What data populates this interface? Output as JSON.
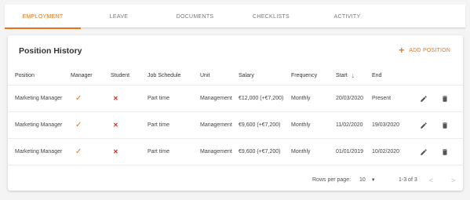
{
  "tabs": [
    {
      "label": "EMPLOYMENT",
      "active": true
    },
    {
      "label": "LEAVE",
      "active": false
    },
    {
      "label": "DOCUMENTS",
      "active": false
    },
    {
      "label": "CHECKLISTS",
      "active": false
    },
    {
      "label": "ACTIVITY",
      "active": false
    }
  ],
  "card": {
    "title": "Position History",
    "add_label": "ADD POSITION",
    "add_icon": "+"
  },
  "columns": {
    "position": "Position",
    "manager": "Manager",
    "student": "Student",
    "job_schedule": "Job Schedule",
    "unit": "Unit",
    "salary": "Salary",
    "frequency": "Frequency",
    "start": "Start",
    "end": "End"
  },
  "rows": [
    {
      "position": "Marketing Manager",
      "manager": "✓",
      "student": "✕",
      "job_schedule": "Part time",
      "unit": "Management",
      "salary": "€12,000 (+€7,200)",
      "frequency": "Monthly",
      "start": "20/03/2020",
      "end": "Present"
    },
    {
      "position": "Marketing Manager",
      "manager": "✓",
      "student": "✕",
      "job_schedule": "Part time",
      "unit": "Management",
      "salary": "€9,600 (+€7,200)",
      "frequency": "Monthly",
      "start": "11/02/2020",
      "end": "19/03/2020"
    },
    {
      "position": "Marketing Manager",
      "manager": "✓",
      "student": "✕",
      "job_schedule": "Part time",
      "unit": "Management",
      "salary": "€9,600 (+€7,200)",
      "frequency": "Monthly",
      "start": "01/01/2019",
      "end": "10/02/2020"
    }
  ],
  "footer": {
    "rows_per_page_label": "Rows per page:",
    "rows_per_page_value": "10",
    "range": "1-3 of 3"
  },
  "colors": {
    "accent": "#e8731a",
    "negative": "#d93025"
  },
  "icons": {
    "sort": "arrow-down-icon",
    "edit": "pencil-icon",
    "delete": "trash-icon",
    "prev": "chevron-left-icon",
    "next": "chevron-right-icon"
  }
}
